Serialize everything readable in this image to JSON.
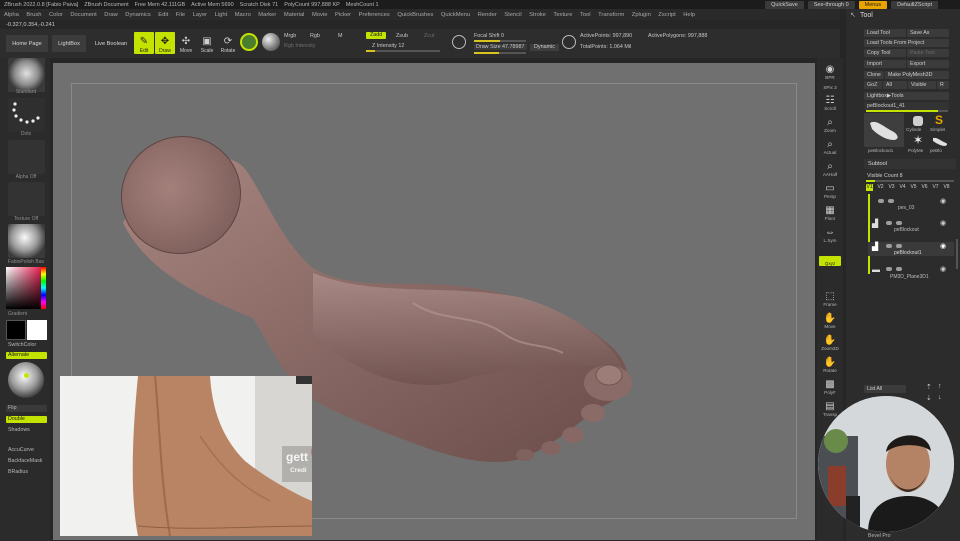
{
  "titlebar": {
    "segments": [
      "ZBrush 2022.0.8 [Fabio Paiva]",
      "ZBrush Document",
      "Free Mem 42.111GB",
      "Active Mem 5690",
      "Scratch Disk 71",
      "PolyCount 997,888 KP",
      "MeshCount 1"
    ],
    "quicksave": "QuickSave",
    "seethrough": "See-through 0",
    "menus": "Menus",
    "script": "DefaultZScript"
  },
  "menubar": {
    "items": [
      "Alpha",
      "Brush",
      "Color",
      "Document",
      "Draw",
      "Dynamics",
      "Edit",
      "File",
      "Layer",
      "Light",
      "Macro",
      "Marker",
      "Material",
      "Movie",
      "Picker",
      "Preferences",
      "QuickBrushes",
      "QuickMenu",
      "Render",
      "Stencil",
      "Stroke",
      "Texture",
      "Tool",
      "Transform",
      "Zplugin",
      "Zscript",
      "Help"
    ]
  },
  "coords": "-0.327,0.354,-0.241",
  "toolbar": {
    "home": "Home Page",
    "lightbox": "LightBox",
    "live_boolean": "Live Boolean",
    "edit": "Edit",
    "draw": "Draw",
    "move": "Move",
    "scale": "Scale",
    "rotate": "Rotate",
    "mrgb": "Mrgb",
    "rgb": "Rgb",
    "m": "M",
    "rgb_intensity": "Rgb Intensity",
    "zadd": "Zadd",
    "zsub": "Zsub",
    "zcut": "Zcut",
    "z_intensity": "Z Intensity 12",
    "focal_shift": "Focal Shift 0",
    "draw_size": "Draw Size 47.78987",
    "dynamic": "Dynamic",
    "active_points": "ActivePoints: 997,890",
    "active_polygons": "ActivePolygons: 997,888",
    "total_points": "TotalPoints: 1.064 Mil"
  },
  "leftshelf": {
    "standard": "Standard",
    "dots": "Dots",
    "alpha_off": "Alpha Off",
    "texture_off": "Texture Off",
    "material": "FabioPolish Bas",
    "gradient": "Gradient",
    "switchcolor": "SwitchColor",
    "alternate": "Alternate",
    "flip": "Flip",
    "double": "Double",
    "shadows": "Shadows",
    "accucurve": "AccuCurve",
    "backfacemask": "BackfaceMask",
    "bradius": "BRadius"
  },
  "ricons": {
    "bpr": "BPR",
    "spix": "SPix 3",
    "scroll": "Scroll",
    "zoom": "Zoom",
    "actual": "Actual",
    "aahalf": "AAHalf",
    "persp": "Persp",
    "floor": "Floor",
    "lsym": "L.Sym",
    "xyz": "Qxyz",
    "frame": "Frame",
    "move": "Move",
    "zoom3d": "Zoom3D",
    "rotate": "Rotate",
    "polyf": "PolyF",
    "transp": "Transp"
  },
  "toolpanel": {
    "title": "Tool",
    "load_tool": "Load Tool",
    "save_as": "Save As",
    "load_from_project": "Load Tools From Project",
    "copy_tool": "Copy Tool",
    "paste_tool": "Paste Tool",
    "import": "Import",
    "export": "Export",
    "clone": "Clone",
    "make_polymesh": "Make PolyMesh3D",
    "goz": "GoZ",
    "all": "All",
    "visible": "Visible",
    "r": "R",
    "lightbox_tools": "Lightbox▶Tools",
    "current_tool": "peBlockout1_41",
    "current_tool_caption": "peBlockout1",
    "cylinder": "Cylinde",
    "simple": "SimpleI",
    "polymesh": "PolyMe",
    "peblo": "peBlo",
    "subtool": "Subtool",
    "visible_count": "Visible Count 8",
    "v_buttons": [
      "V1",
      "V2",
      "V3",
      "V4",
      "V5",
      "V6",
      "V7",
      "V8"
    ],
    "subtools": [
      "pes_03",
      "peBlockout",
      "peBlockout1",
      "PM3D_Plane3D1"
    ],
    "list_all": "List All",
    "bevel_pro": "Bevel Pro"
  },
  "refphoto": {
    "watermark": "gett",
    "credit": "Credi"
  },
  "colors": {
    "accent": "#c5e300",
    "orange": "#e9a400",
    "canvas": "#707070",
    "skin": "#8c6b66"
  }
}
